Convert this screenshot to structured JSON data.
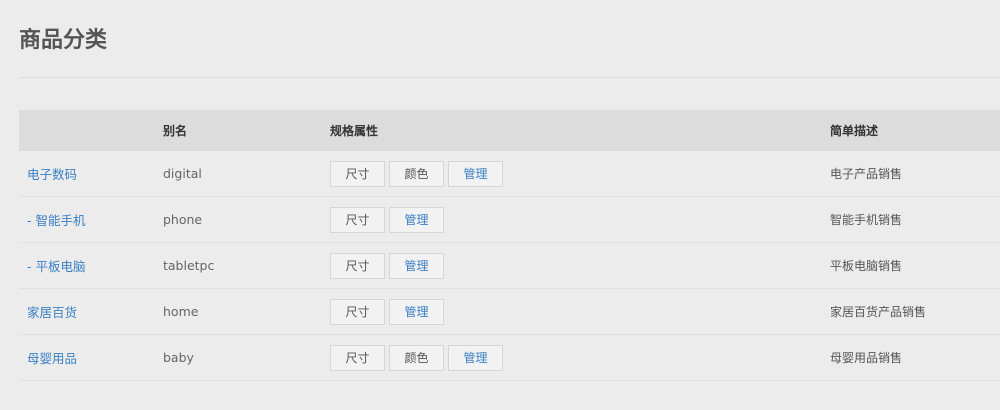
{
  "page": {
    "title": "商品分类"
  },
  "table": {
    "headers": {
      "name": "",
      "alias": "别名",
      "spec": "规格属性",
      "desc": "简单描述"
    },
    "rows": [
      {
        "name": "电子数码",
        "alias": "digital",
        "specs": [
          "尺寸",
          "颜色"
        ],
        "manage": "管理",
        "desc": "电子产品销售"
      },
      {
        "name": "- 智能手机",
        "alias": "phone",
        "specs": [
          "尺寸"
        ],
        "manage": "管理",
        "desc": "智能手机销售"
      },
      {
        "name": "- 平板电脑",
        "alias": "tabletpc",
        "specs": [
          "尺寸"
        ],
        "manage": "管理",
        "desc": "平板电脑销售"
      },
      {
        "name": "家居百货",
        "alias": "home",
        "specs": [
          "尺寸"
        ],
        "manage": "管理",
        "desc": "家居百货产品销售"
      },
      {
        "name": "母婴用品",
        "alias": "baby",
        "specs": [
          "尺寸",
          "颜色"
        ],
        "manage": "管理",
        "desc": "母婴用品销售"
      }
    ]
  },
  "colors": {
    "background": "#ececec",
    "header_background": "#dcdcdc",
    "link": "#3a7fc4",
    "text": "#555555"
  }
}
